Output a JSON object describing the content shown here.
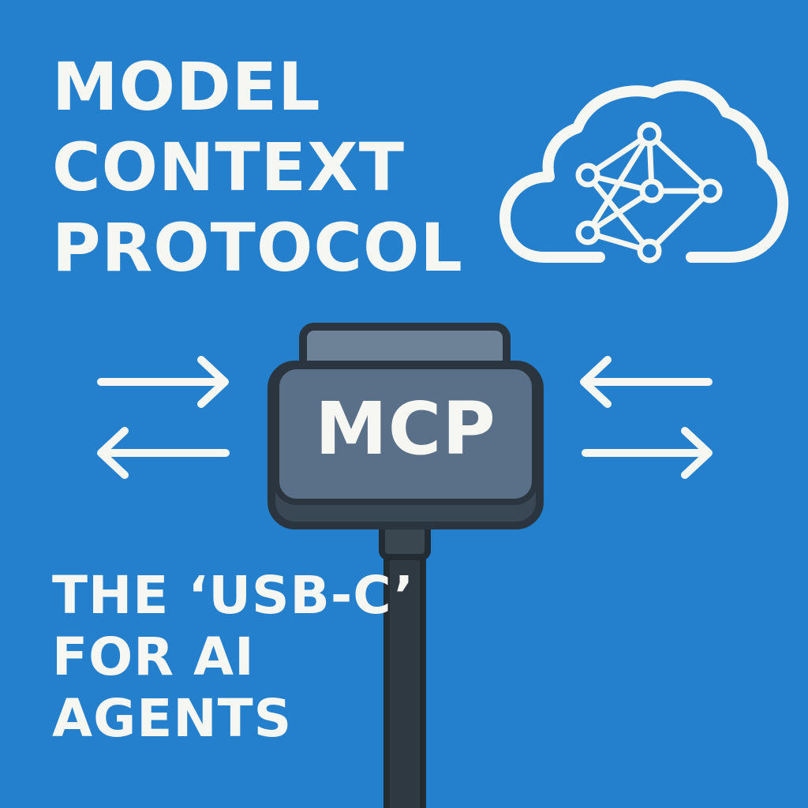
{
  "colors": {
    "background": "#2480cc",
    "text": "#f6f6f2",
    "connector_body": "#5a7088",
    "connector_top": "#6d8296",
    "connector_outline": "#2b353f",
    "cable": "#2f3942"
  },
  "title": {
    "line1": "MODEL",
    "line2": "CONTEXT",
    "line3": "PROTOCOL"
  },
  "connector": {
    "label": "MCP"
  },
  "subtitle": {
    "line1": "THE ‘USB-C’",
    "line2": "FOR AI",
    "line3": "AGENTS"
  },
  "icons": {
    "cloud": "cloud-network-icon",
    "arrows": [
      "arrow-right-icon",
      "arrow-left-icon",
      "arrow-left-icon",
      "arrow-right-icon"
    ],
    "connector": "usb-c-connector-icon"
  }
}
